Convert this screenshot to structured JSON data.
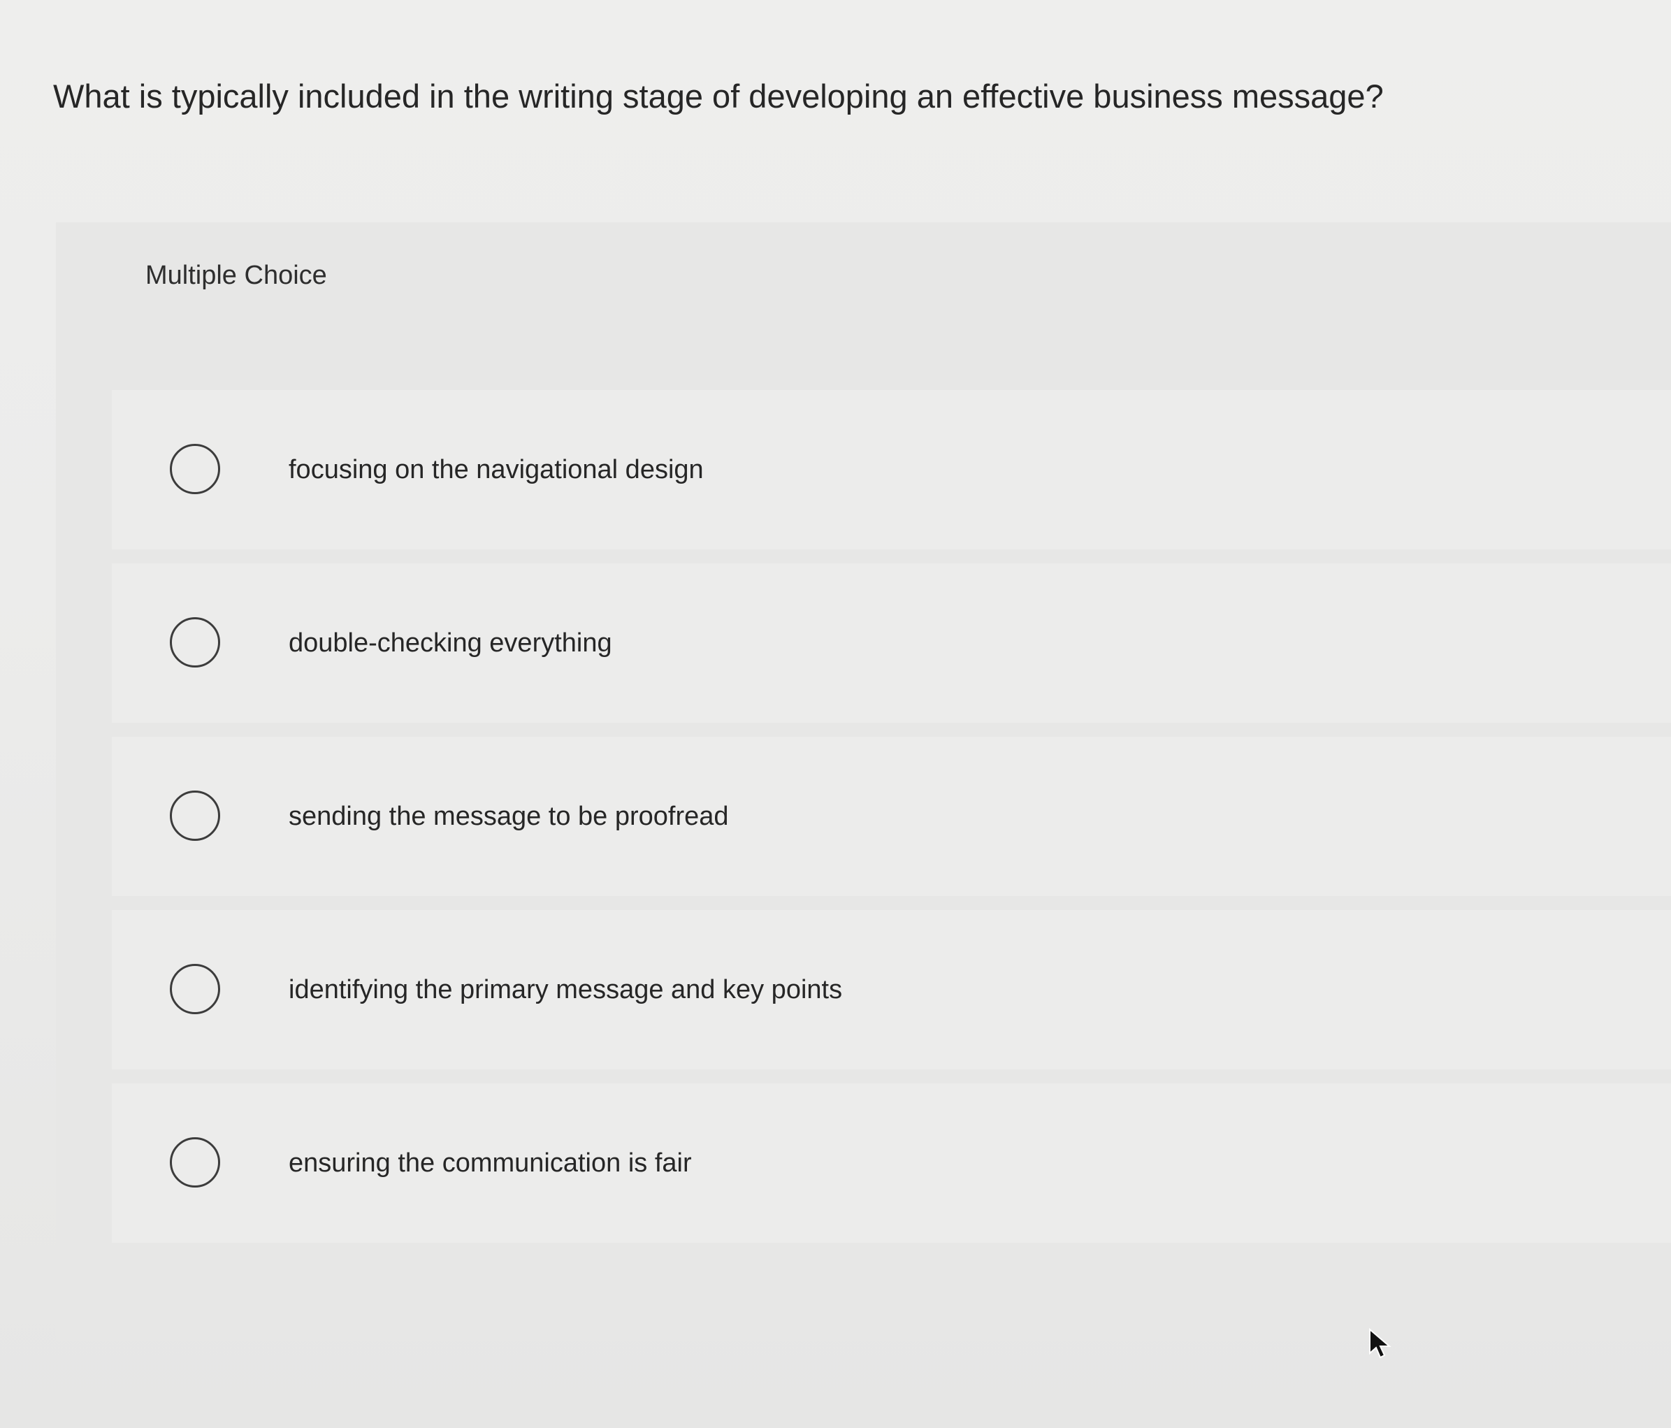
{
  "question": {
    "text": "What is typically included in the writing stage of developing an effective business message?"
  },
  "panel": {
    "label": "Multiple Choice"
  },
  "options": [
    {
      "text": "focusing on the navigational design",
      "selected": false
    },
    {
      "text": "double-checking everything",
      "selected": false
    },
    {
      "text": "sending the message to be proofread",
      "selected": false
    },
    {
      "text": "identifying the primary message and key points",
      "selected": false
    },
    {
      "text": "ensuring the communication is fair",
      "selected": false
    }
  ],
  "icons": {
    "option_radio": "radio-button-unselected-icon",
    "pointer": "mouse-pointer-icon"
  },
  "colors": {
    "background": "#ececeb",
    "text": "#262626",
    "radio_border": "#3c3c3c"
  }
}
